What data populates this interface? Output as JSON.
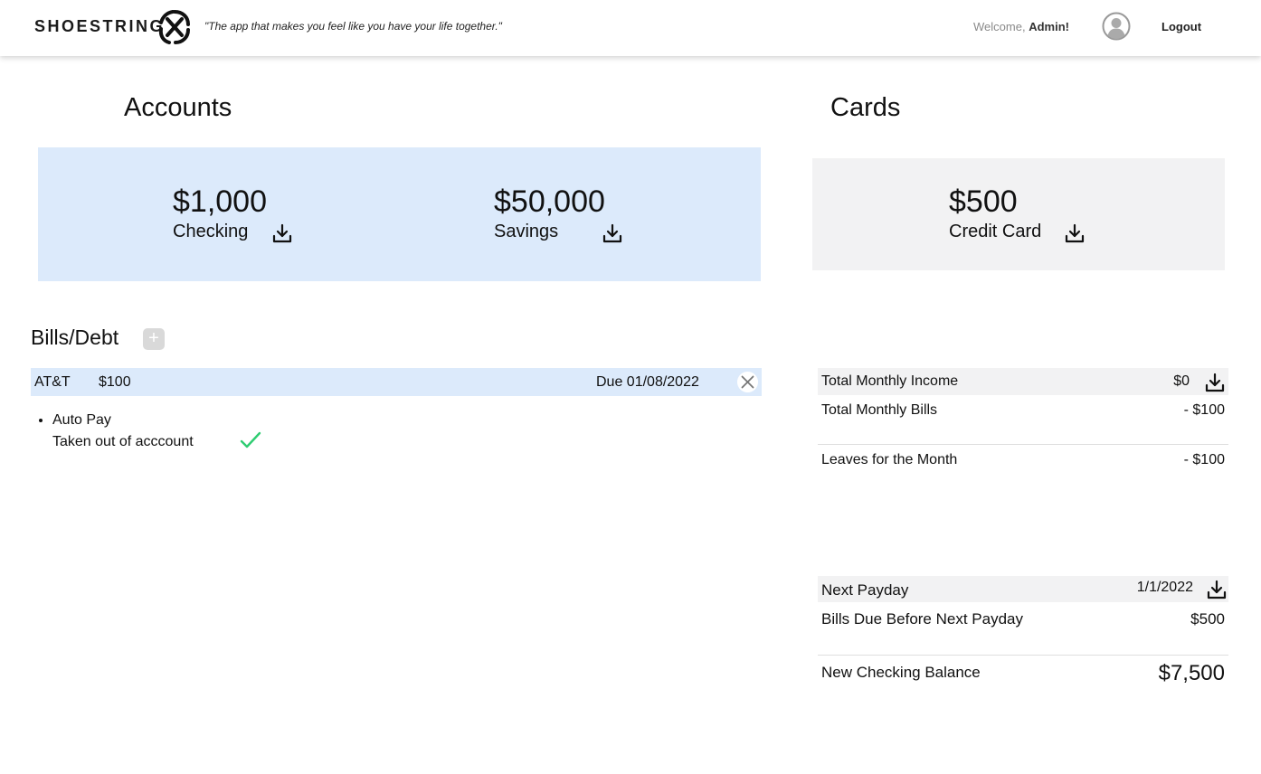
{
  "header": {
    "brand": "SHOESTRING",
    "tagline": "\"The app that makes you feel like you have your life together.\"",
    "welcome_prefix": "Welcome,",
    "username": "Admin!",
    "logout_label": "Logout"
  },
  "accounts": {
    "title": "Accounts",
    "items": [
      {
        "amount": "$1,000",
        "name": "Checking",
        "icon": "download-icon"
      },
      {
        "amount": "$50,000",
        "name": "Savings",
        "icon": "download-icon"
      }
    ]
  },
  "cards": {
    "title": "Cards",
    "items": [
      {
        "amount": "$500",
        "name": "Credit Card",
        "icon": "download-icon"
      }
    ]
  },
  "bills": {
    "title": "Bills/Debt",
    "add_label": "+",
    "items": [
      {
        "name": "AT&T",
        "amount": "$100",
        "due": "Due 01/08/2022",
        "detail_title": "Auto Pay",
        "detail_status": "Taken out of acccount"
      }
    ]
  },
  "summary": {
    "income_label": "Total Monthly Income",
    "income_value": "$0",
    "bills_label": "Total Monthly Bills",
    "bills_value": "- $100",
    "leaves_label": "Leaves for the Month",
    "leaves_value": "- $100",
    "payday_label": "Next Payday",
    "payday_value": "1/1/2022",
    "due_before_label": "Bills Due Before Next Payday",
    "due_before_value": "$500",
    "new_balance_label": "New Checking Balance",
    "new_balance_value": "$7,500"
  },
  "colors": {
    "accent_blue": "#dceafb",
    "neutral_panel": "#f2f2f3",
    "check_green": "#2ecc71"
  }
}
